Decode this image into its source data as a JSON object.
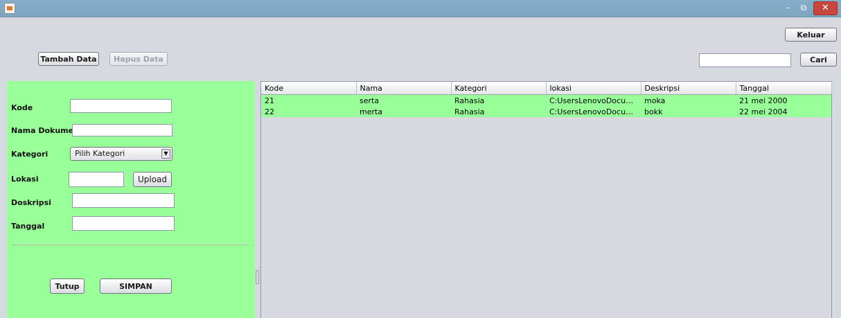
{
  "window": {
    "minimize_glyph": "–",
    "maximize_glyph": "⧉",
    "close_glyph": "✕"
  },
  "toolbar": {
    "keluar_label": "Keluar",
    "tambah_label": "Tambah Data",
    "hapus_label": "Hapus Data",
    "search_value": "",
    "cari_label": "Cari"
  },
  "form": {
    "kode": {
      "label": "Kode",
      "value": ""
    },
    "nama": {
      "label": "Nama Dokumen",
      "value": ""
    },
    "kategori": {
      "label": "Kategori",
      "selected": "Pilih Kategori"
    },
    "lokasi": {
      "label": "Lokasi",
      "value": "",
      "upload_label": "Upload"
    },
    "deskripsi": {
      "label": "Doskripsi",
      "value": ""
    },
    "tanggal": {
      "label": "Tanggal",
      "value": ""
    },
    "tutup_label": "Tutup",
    "simpan_label": "SIMPAN"
  },
  "table": {
    "columns": [
      "Kode",
      "Nama",
      "Kategori",
      "lokasi",
      "Deskripsi",
      "Tanggal"
    ],
    "rows": [
      [
        "21",
        "serta",
        "Rahasia",
        "C:UsersLenovoDocume...",
        "moka",
        "21 mei 2000"
      ],
      [
        "22",
        "merta",
        "Rahasia",
        "C:UsersLenovoDocume...",
        "bokk",
        "22 mei 2004"
      ]
    ]
  },
  "colors": {
    "form_background": "#99ff99",
    "row_highlight": "#99ff99",
    "titlebar": "#7ea5bf",
    "close_button": "#c9463d"
  }
}
